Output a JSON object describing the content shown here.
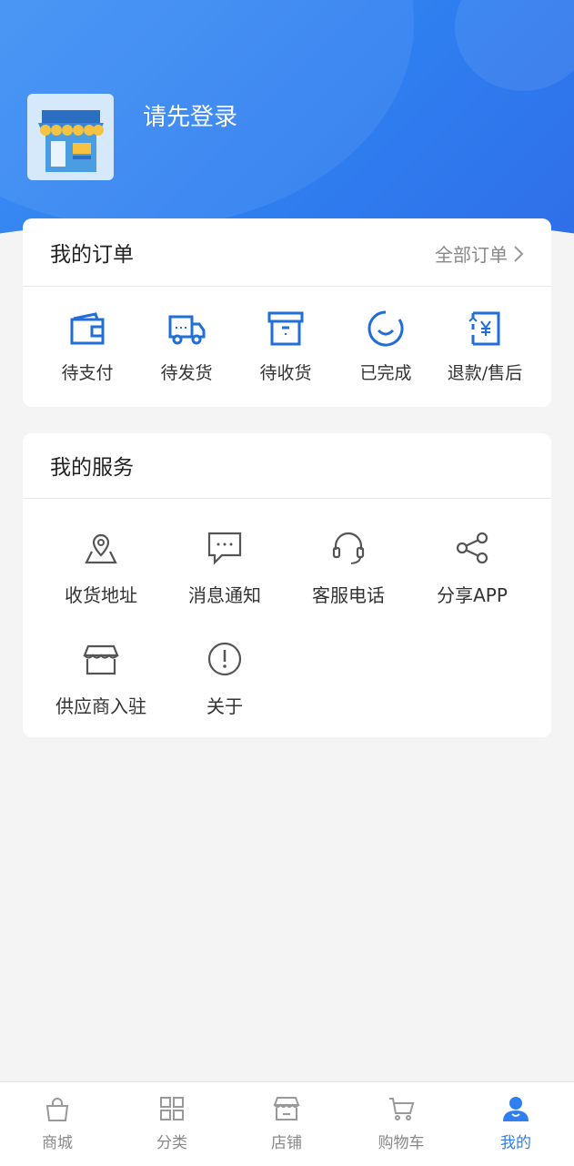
{
  "header": {
    "login_prompt": "请先登录"
  },
  "orders": {
    "title": "我的订单",
    "all_orders_label": "全部订单",
    "items": [
      {
        "label": "待支付",
        "icon": "wallet-icon"
      },
      {
        "label": "待发货",
        "icon": "delivery-truck-icon"
      },
      {
        "label": "待收货",
        "icon": "package-box-icon"
      },
      {
        "label": "已完成",
        "icon": "completed-smile-icon"
      },
      {
        "label": "退款/售后",
        "icon": "refund-receipt-icon"
      }
    ]
  },
  "services": {
    "title": "我的服务",
    "items": [
      {
        "label": "收货地址",
        "icon": "location-pin-icon"
      },
      {
        "label": "消息通知",
        "icon": "message-bubble-icon"
      },
      {
        "label": "客服电话",
        "icon": "headset-icon"
      },
      {
        "label": "分享APP",
        "icon": "share-icon"
      },
      {
        "label": "供应商入驻",
        "icon": "store-icon"
      },
      {
        "label": "关于",
        "icon": "info-exclamation-icon"
      }
    ]
  },
  "tabbar": {
    "items": [
      {
        "label": "商城",
        "icon": "shopping-bag-icon",
        "active": false
      },
      {
        "label": "分类",
        "icon": "grid-icon",
        "active": false
      },
      {
        "label": "店铺",
        "icon": "shop-icon",
        "active": false
      },
      {
        "label": "购物车",
        "icon": "cart-icon",
        "active": false
      },
      {
        "label": "我的",
        "icon": "user-icon",
        "active": true
      }
    ]
  },
  "colors": {
    "primary": "#2f7ff0",
    "order_icon": "#1f6fd6",
    "inactive_tab": "#888888"
  }
}
